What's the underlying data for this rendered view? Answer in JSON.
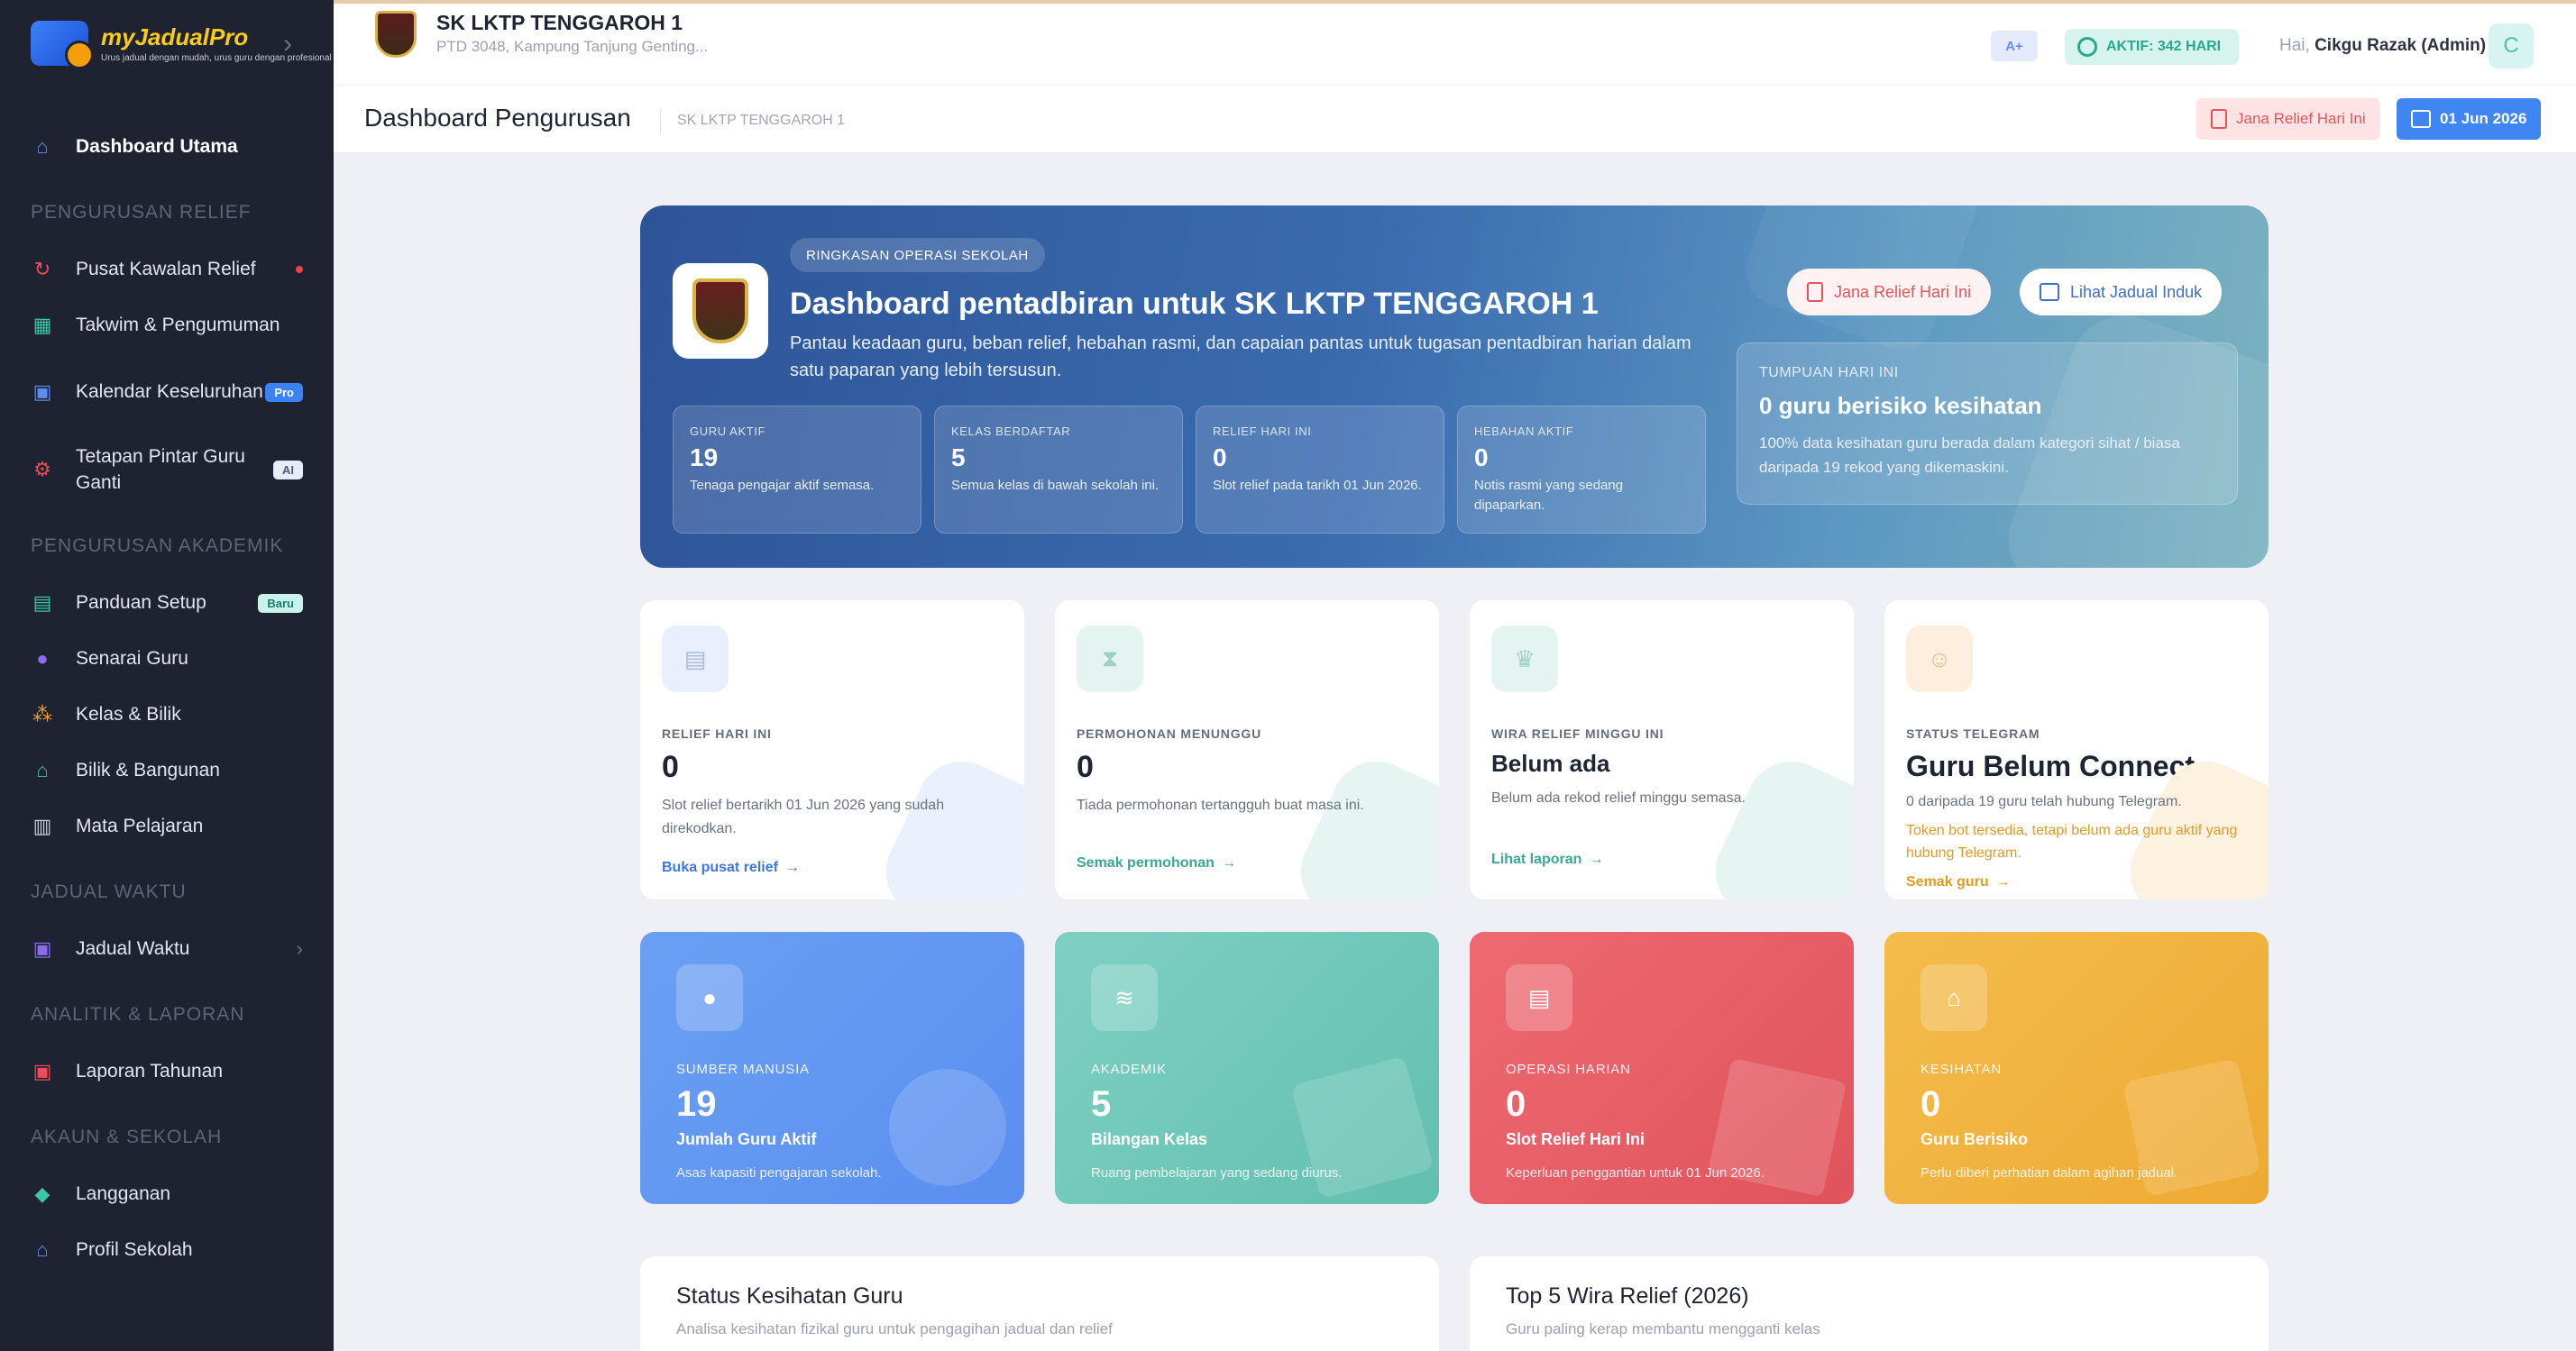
{
  "app": {
    "brand": "myJadualPro",
    "brand_tagline": "Urus jadual dengan mudah, urus guru dengan profesional",
    "colors": {
      "sidebar_bg": "#1f2331",
      "accent": "#3f86f2",
      "danger": "#e0565b",
      "teal": "#2aa88f",
      "amber": "#e39a25"
    }
  },
  "sidebar": {
    "items": [
      {
        "label": "Dashboard Utama",
        "icon": "home-icon"
      }
    ],
    "sections": [
      {
        "title": "PENGURUSAN RELIEF",
        "items": [
          {
            "label": "Pusat Kawalan Relief",
            "icon": "refresh-icon"
          },
          {
            "label": "Takwim & Pengumuman",
            "icon": "calendar-grid-icon"
          },
          {
            "label": "Kalendar Keseluruhan",
            "icon": "calendar-check-icon",
            "badge": "Pro"
          },
          {
            "label": "Tetapan Pintar Guru Ganti",
            "icon": "gear-icon",
            "badge": "AI"
          }
        ]
      },
      {
        "title": "PENGURUSAN AKADEMIK",
        "items": [
          {
            "label": "Panduan Setup",
            "icon": "book-icon",
            "badge": "Baru"
          },
          {
            "label": "Senarai Guru",
            "icon": "user-icon"
          },
          {
            "label": "Kelas & Bilik",
            "icon": "users-icon"
          },
          {
            "label": "Bilik & Bangunan",
            "icon": "building-icon"
          },
          {
            "label": "Mata Pelajaran",
            "icon": "book-open-icon"
          }
        ]
      },
      {
        "title": "JADUAL WAKTU",
        "items": [
          {
            "label": "Jadual Waktu",
            "icon": "calendar-icon"
          }
        ]
      },
      {
        "title": "ANALITIK & LAPORAN",
        "items": [
          {
            "label": "Laporan Tahunan",
            "icon": "calendar-report-icon"
          }
        ]
      },
      {
        "title": "AKAUN & SEKOLAH",
        "items": [
          {
            "label": "Langganan",
            "icon": "gem-icon"
          },
          {
            "label": "Profil Sekolah",
            "icon": "school-icon"
          }
        ]
      }
    ]
  },
  "topbar": {
    "school_name": "SK LKTP TENGGAROH 1",
    "school_address": "PTD 3048, Kampung Tanjung Genting...",
    "font_chip": "A+",
    "active_status": "AKTIF: 342 HARI",
    "greeting_prefix": "Hai,",
    "user_name": "Cikgu Razak (Admin)",
    "avatar_initial": "C"
  },
  "page_header": {
    "title": "Dashboard Pengurusan",
    "breadcrumb": "SK LKTP TENGGAROH 1",
    "relief_button": "Jana Relief Hari Ini",
    "date_button": "01 Jun 2026"
  },
  "hero": {
    "tag": "RINGKASAN OPERASI SEKOLAH",
    "title": "Dashboard pentadbiran untuk SK LKTP TENGGAROH 1",
    "description": "Pantau keadaan guru, beban relief, hebahan rasmi, dan capaian pantas untuk tugasan pentadbiran harian dalam satu paparan yang lebih tersusun.",
    "button_relief": "Jana Relief Hari Ini",
    "button_schedule": "Lihat Jadual Induk",
    "stats": [
      {
        "label": "GURU AKTIF",
        "value": "19",
        "sub": "Tenaga pengajar aktif semasa."
      },
      {
        "label": "KELAS BERDAFTAR",
        "value": "5",
        "sub": "Semua kelas di bawah sekolah ini."
      },
      {
        "label": "RELIEF HARI INI",
        "value": "0",
        "sub": "Slot relief pada tarikh 01 Jun 2026."
      },
      {
        "label": "HEBAHAN AKTIF",
        "value": "0",
        "sub": "Notis rasmi yang sedang dipaparkan."
      }
    ],
    "focus": {
      "label": "TUMPUAN HARI INI",
      "title": "0 guru berisiko kesihatan",
      "description": "100% data kesihatan guru berada dalam kategori sihat / biasa daripada 19 rekod yang dikemaskini."
    }
  },
  "info_cards": [
    {
      "label": "RELIEF HARI INI",
      "value": "0",
      "description": "Slot relief bertarikh 01 Jun 2026 yang sudah direkodkan.",
      "link": "Buka pusat relief",
      "icon": "document-icon"
    },
    {
      "label": "PERMOHONAN MENUNGGU",
      "value": "0",
      "description": "Tiada permohonan tertangguh buat masa ini.",
      "link": "Semak permohonan",
      "icon": "hourglass-icon"
    },
    {
      "label": "WIRA RELIEF MINGGU INI",
      "value": "Belum ada",
      "description": "Belum ada rekod relief minggu semasa.",
      "link": "Lihat laporan",
      "icon": "trophy-icon"
    },
    {
      "label": "STATUS TELEGRAM",
      "value": "Guru Belum Connect",
      "description": "0 daripada 19 guru telah hubung Telegram.",
      "warning": "Token bot tersedia, tetapi belum ada guru aktif yang hubung Telegram.",
      "link": "Semak guru",
      "icon": "chat-icon"
    }
  ],
  "metric_cards": [
    {
      "label": "SUMBER MANUSIA",
      "value": "19",
      "title": "Jumlah Guru Aktif",
      "description": "Asas kapasiti pengajaran sekolah.",
      "icon": "person-icon"
    },
    {
      "label": "AKADEMIK",
      "value": "5",
      "title": "Bilangan Kelas",
      "description": "Ruang pembelajaran yang sedang diurus.",
      "icon": "layers-icon"
    },
    {
      "label": "OPERASI HARIAN",
      "value": "0",
      "title": "Slot Relief Hari Ini",
      "description": "Keperluan penggantian untuk 01 Jun 2026.",
      "icon": "clipboard-icon"
    },
    {
      "label": "KESIHATAN",
      "value": "0",
      "title": "Guru Berisiko",
      "description": "Perlu diberi perhatian dalam agihan jadual.",
      "icon": "medical-house-icon"
    }
  ],
  "panels": [
    {
      "title": "Status Kesihatan Guru",
      "subtitle": "Analisa kesihatan fizikal guru untuk pengagihan jadual dan relief"
    },
    {
      "title": "Top 5 Wira Relief (2026)",
      "subtitle": "Guru paling kerap membantu mengganti kelas"
    }
  ]
}
